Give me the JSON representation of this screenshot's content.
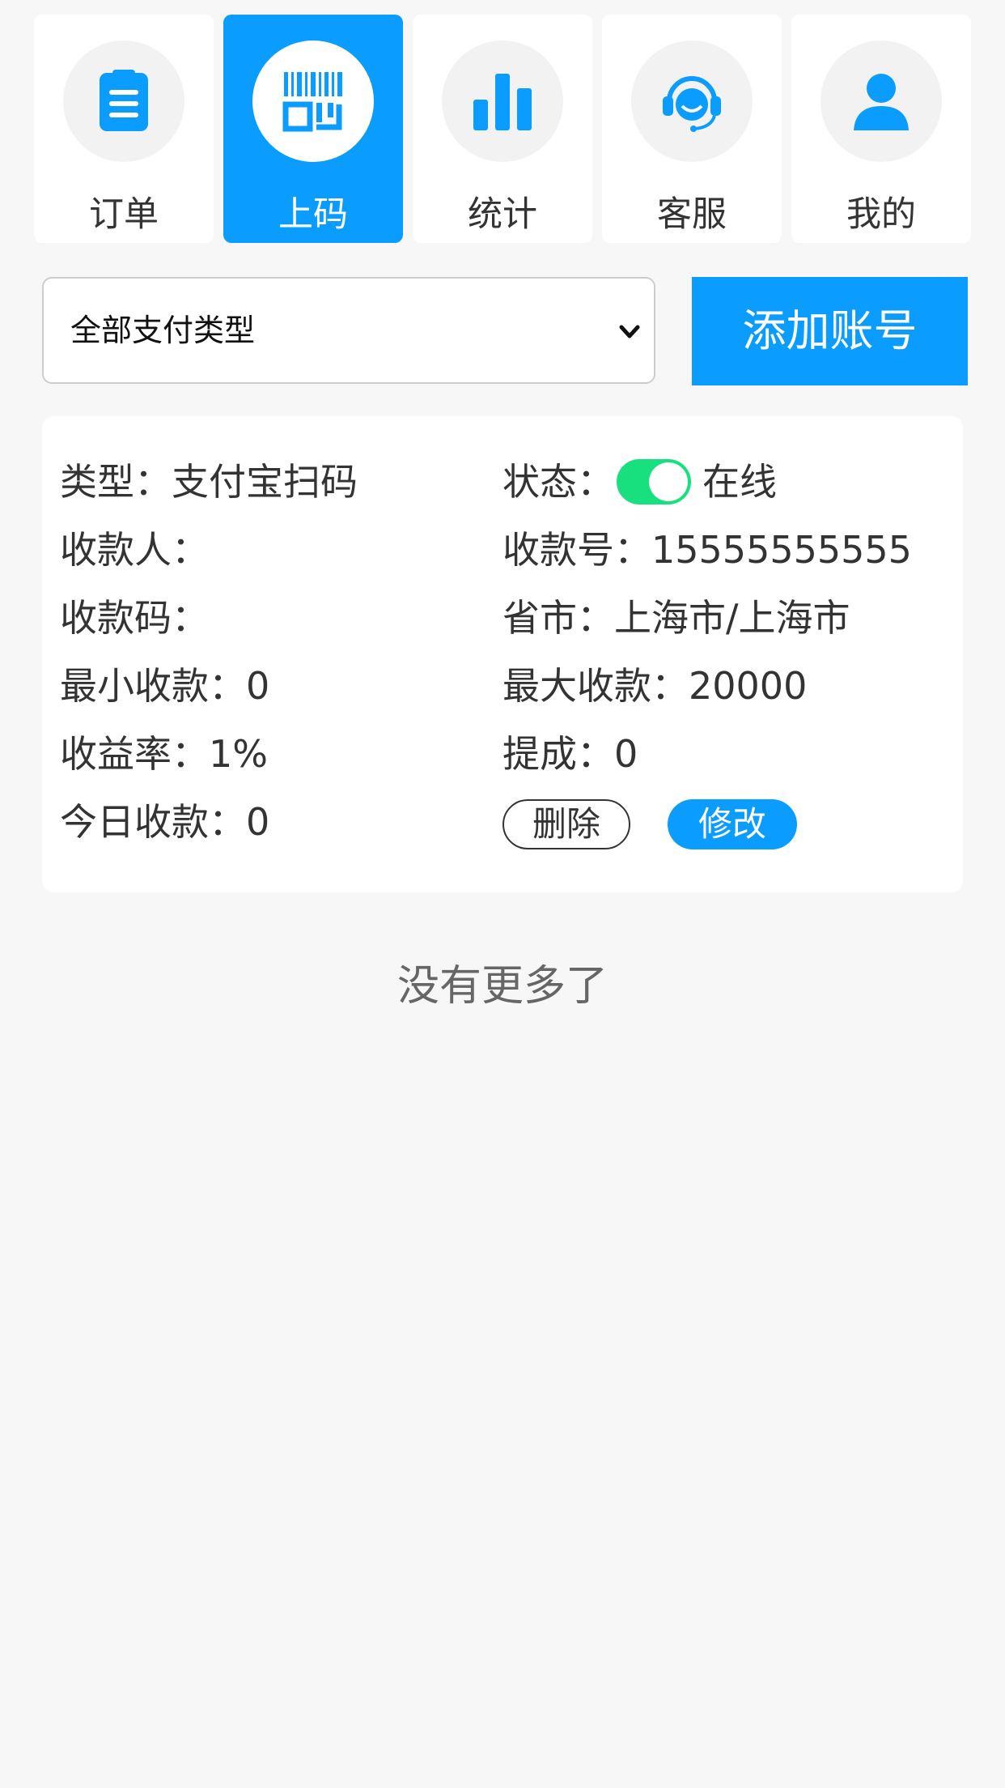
{
  "nav": {
    "items": [
      {
        "label": "订单",
        "icon": "clipboard-icon",
        "active": false
      },
      {
        "label": "上码",
        "icon": "barcode-icon",
        "active": true
      },
      {
        "label": "统计",
        "icon": "bar-chart-icon",
        "active": false
      },
      {
        "label": "客服",
        "icon": "headset-icon",
        "active": false
      },
      {
        "label": "我的",
        "icon": "user-icon",
        "active": false
      }
    ]
  },
  "filter": {
    "selected": "全部支付类型",
    "add_button": "添加账号"
  },
  "account": {
    "type_label": "类型：",
    "type_value": "支付宝扫码",
    "status_label": "状态：",
    "status_on": true,
    "status_value": "在线",
    "payee_label": "收款人：",
    "payee_value": "",
    "number_label": "收款号：",
    "number_value": "15555555555",
    "qrcode_label": "收款码：",
    "qrcode_value": "",
    "region_label": "省市：",
    "region_value": "上海市/上海市",
    "min_label": "最小收款：",
    "min_value": "0",
    "max_label": "最大收款：",
    "max_value": "20000",
    "rate_label": "收益率：",
    "rate_value": "1%",
    "commission_label": "提成：",
    "commission_value": "0",
    "today_label": "今日收款：",
    "today_value": "0",
    "delete_button": "删除",
    "edit_button": "修改"
  },
  "footer": {
    "no_more": "没有更多了"
  },
  "colors": {
    "accent": "#0a9cff",
    "switch_on": "#19e07f",
    "background": "#f7f7f7",
    "text": "#333333"
  }
}
